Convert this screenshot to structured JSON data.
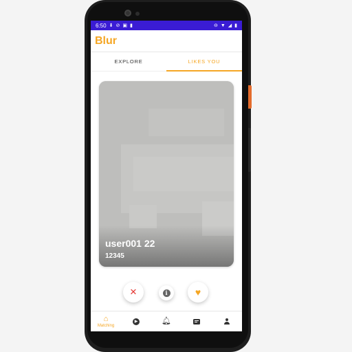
{
  "status_bar": {
    "time": "6:50",
    "left_icons": [
      "download-icon",
      "do-not-disturb-icon",
      "sim-icon",
      "sd-card-icon"
    ],
    "right_icons": [
      "dnd-circle-icon",
      "wifi-icon",
      "signal-icon",
      "battery-icon"
    ]
  },
  "app": {
    "title": "Blur",
    "accent_color": "#f5a623",
    "status_bar_color": "#3a1cd4"
  },
  "tabs": [
    {
      "label": "EXPLORE",
      "active": false
    },
    {
      "label": "LIKES YOU",
      "active": true
    }
  ],
  "card": {
    "name": "user001 22",
    "subtitle": "12345"
  },
  "actions": {
    "dislike_icon": "close-icon",
    "info_icon": "info-icon",
    "like_icon": "heart-icon"
  },
  "bottom_nav": [
    {
      "icon": "home-icon",
      "label": "Matching",
      "active": true
    },
    {
      "icon": "play-circle-icon",
      "label": "",
      "active": false
    },
    {
      "icon": "bell-icon",
      "label": "",
      "active": false
    },
    {
      "icon": "chat-icon",
      "label": "",
      "active": false
    },
    {
      "icon": "person-icon",
      "label": "",
      "active": false
    }
  ]
}
